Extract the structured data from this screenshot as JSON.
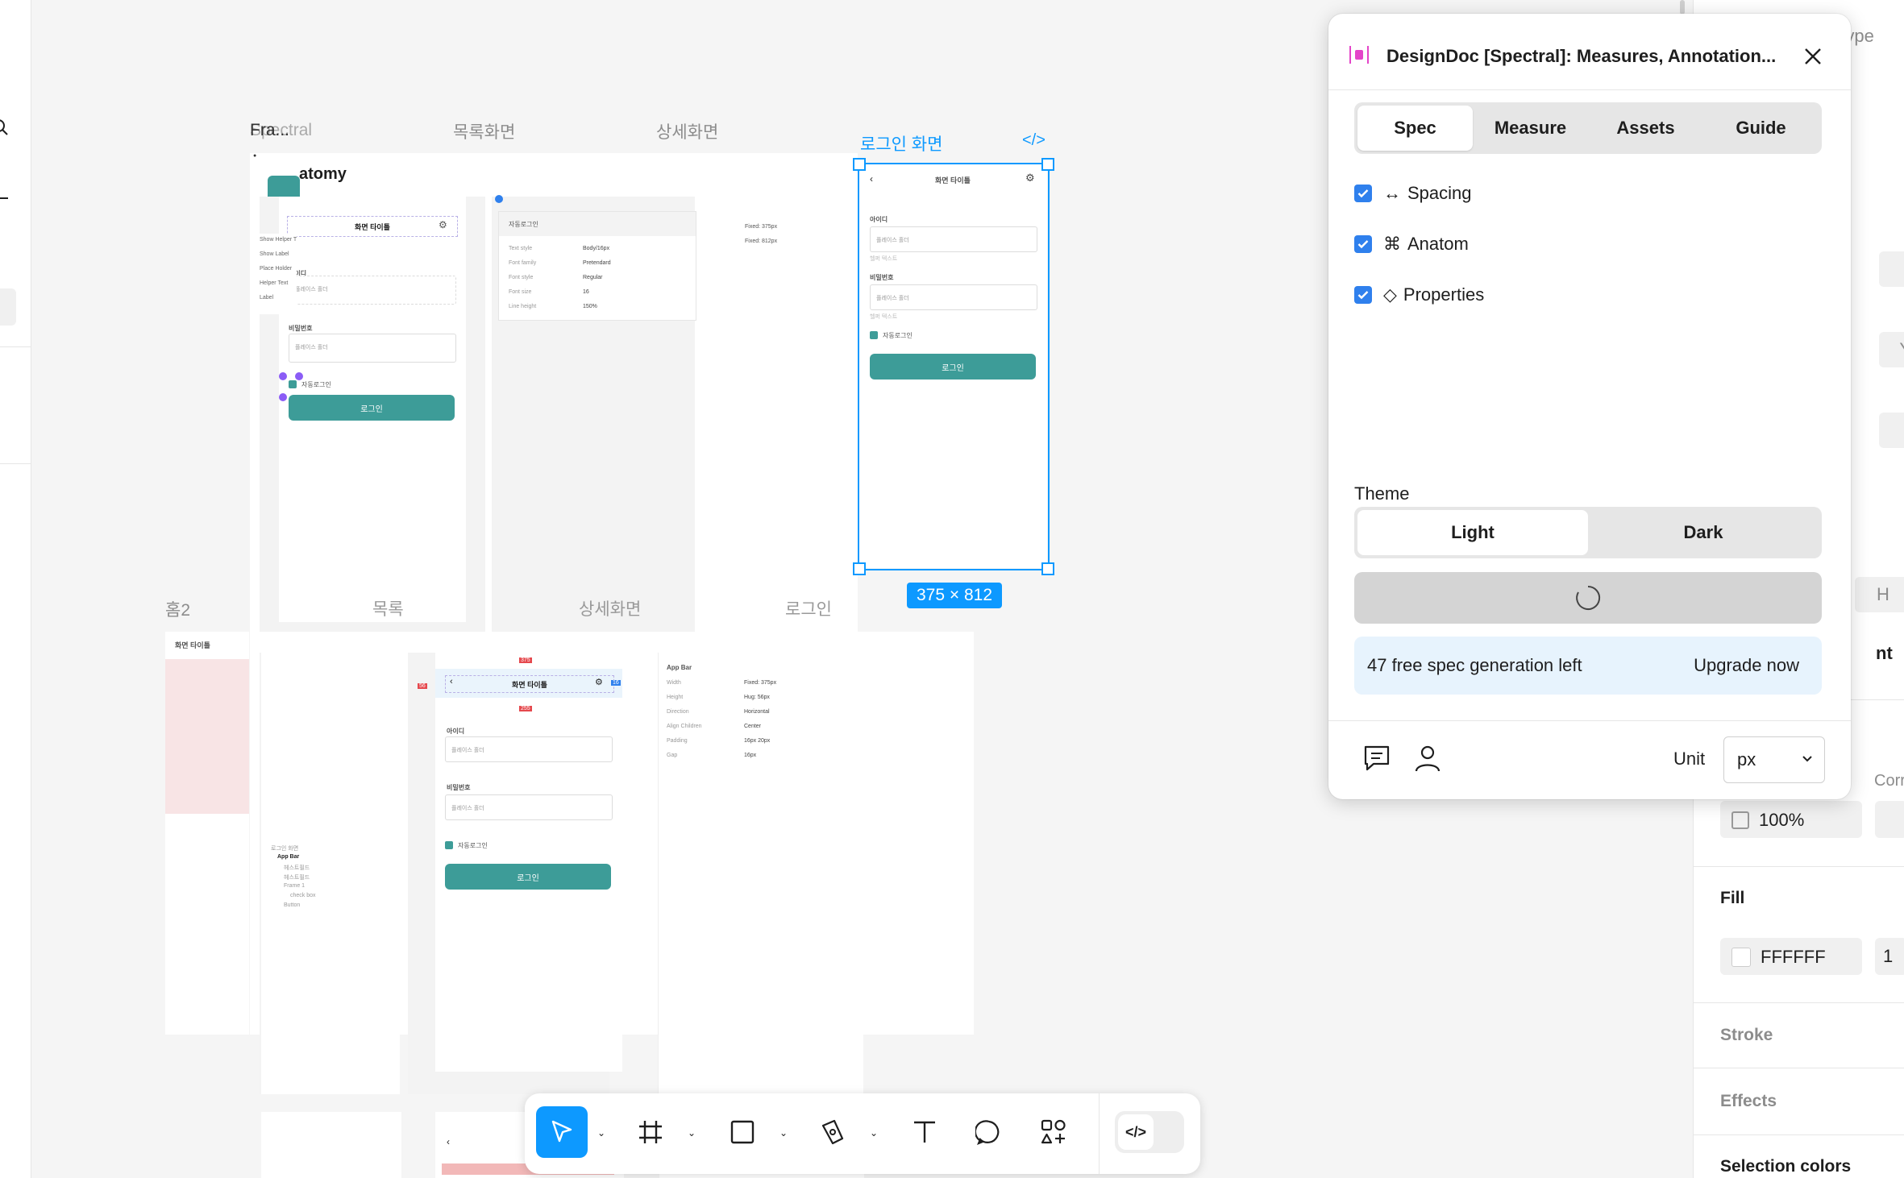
{
  "canvas": {
    "frame_labels": {
      "frame_top": "Fra...",
      "spectral": "Spectral",
      "list_screen": "목록화면",
      "detail_screen": "상세화면",
      "login_screen": "로그인 화면",
      "home2": "홈2",
      "list": "목록",
      "detail": "상세화면",
      "login": "로그인"
    },
    "anatomy_heading": "atomy",
    "selection_size": "375 × 812",
    "mock": {
      "screen_title": "화면 타이틀",
      "id_label": "아이디",
      "password_label": "비밀번호",
      "placeholder": "플레이스 홀더",
      "helper": "헬퍼 텍스트",
      "auto_login": "자동로그인",
      "login_button": "로그인",
      "tooltip_items": [
        "Show Helper T",
        "Show Label",
        "Place Holder",
        "Helper Text",
        "Label"
      ],
      "text_props": {
        "title": "자동로그인",
        "rows": [
          [
            "Text style",
            "Body/16px"
          ],
          [
            "Font family",
            "Pretendard"
          ],
          [
            "Font style",
            "Regular"
          ],
          [
            "Font size",
            "16"
          ],
          [
            "Line height",
            "150%"
          ]
        ]
      },
      "fixed_w": "Fixed: 375px",
      "fixed_h": "Fixed: 812px",
      "app_bar_props": {
        "title": "App Bar",
        "rows": [
          [
            "Width",
            "Fixed: 375px"
          ],
          [
            "Height",
            "Hug: 56px"
          ],
          [
            "Direction",
            "Horizontal"
          ],
          [
            "Align Children",
            "Center"
          ],
          [
            "Padding",
            "16px 20px"
          ],
          [
            "Gap",
            "16px"
          ]
        ]
      },
      "layer_tree": [
        "로그인 화면",
        "App Bar",
        "헤스트필드",
        "헤스트필드",
        "Frame 1",
        "check box",
        "Button"
      ],
      "spacing_tags": {
        "top": "375",
        "left": "56",
        "right": "16",
        "mid": "255"
      }
    }
  },
  "right_panel": {
    "prototype_tab": "otype",
    "axis_y": "Y",
    "axis_h": "H",
    "partial_label": "nt",
    "corner_label": "Corr",
    "opacity_value": "100%",
    "fill_heading": "Fill",
    "fill_hex": "FFFFFF",
    "fill_partial": "1",
    "stroke_heading": "Stroke",
    "effects_heading": "Effects",
    "selection_colors_heading": "Selection colors"
  },
  "plugin": {
    "title": "DesignDoc [Spectral]: Measures, Annotation...",
    "tabs": [
      {
        "label": "Spec",
        "active": true
      },
      {
        "label": "Measure",
        "active": false
      },
      {
        "label": "Assets",
        "active": false
      },
      {
        "label": "Guide",
        "active": false
      }
    ],
    "options": [
      {
        "symbol": "↔",
        "label": "Spacing",
        "checked": true
      },
      {
        "symbol": "⌘",
        "label": "Anatom",
        "checked": true
      },
      {
        "symbol": "◇",
        "label": "Properties",
        "checked": true
      }
    ],
    "theme_label": "Theme",
    "theme_options": [
      {
        "label": "Light",
        "active": true
      },
      {
        "label": "Dark",
        "active": false
      }
    ],
    "notice_text": "47 free spec generation left",
    "upgrade_link": "Upgrade now",
    "unit_label": "Unit",
    "unit_value": "px"
  },
  "toolbar": {
    "tools": [
      "move-tool",
      "frame-tool",
      "shape-tool",
      "pen-tool",
      "text-tool",
      "comment-tool",
      "actions-tool",
      "dev-mode-toggle"
    ]
  },
  "colors": {
    "accent": "#0d99ff",
    "teal": "#3d9c98",
    "checkbox": "#2f80ed",
    "notice_bg": "#e7f3fd"
  }
}
